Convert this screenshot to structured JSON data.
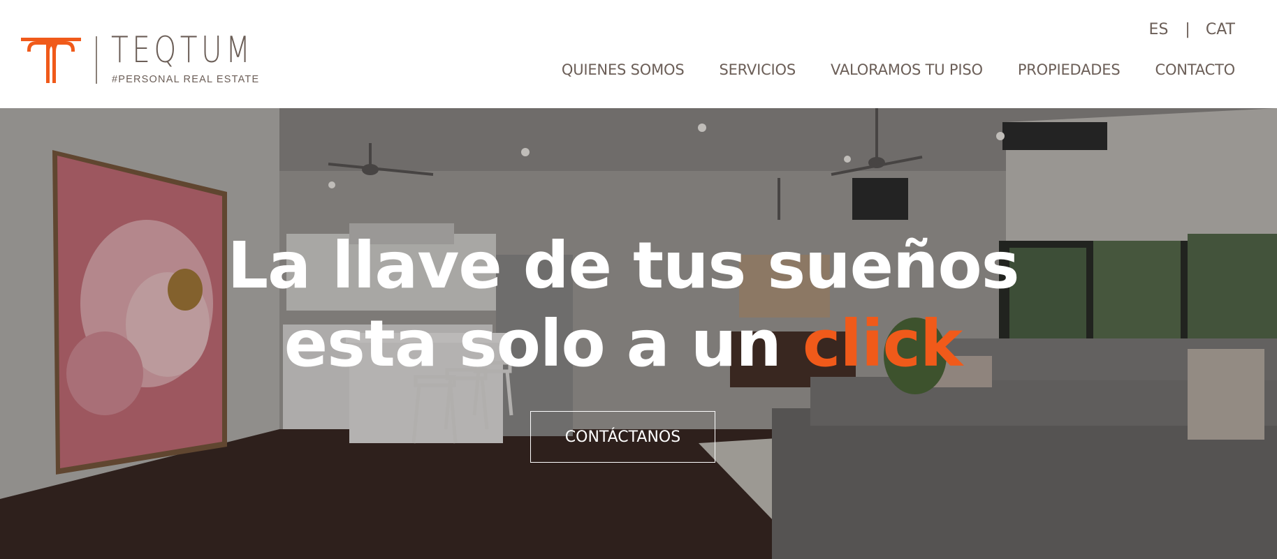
{
  "brand": {
    "name": "TEQTUM",
    "tagline": "#PERSONAL REAL ESTATE",
    "accent_color": "#f05a1a",
    "text_color": "#6b5e57"
  },
  "languages": {
    "items": [
      "ES",
      "CAT"
    ],
    "separator": "|"
  },
  "nav": {
    "items": [
      {
        "label": "QUIENES SOMOS"
      },
      {
        "label": "SERVICIOS"
      },
      {
        "label": "VALORAMOS TU PISO"
      },
      {
        "label": "PROPIEDADES"
      },
      {
        "label": "CONTACTO"
      }
    ]
  },
  "hero": {
    "line1": "La llave de tus sueños",
    "line2": "esta solo a un ",
    "line2_accent": "click",
    "cta_label": "CONTÁCTANOS",
    "background": "interior-living-room-photo"
  }
}
